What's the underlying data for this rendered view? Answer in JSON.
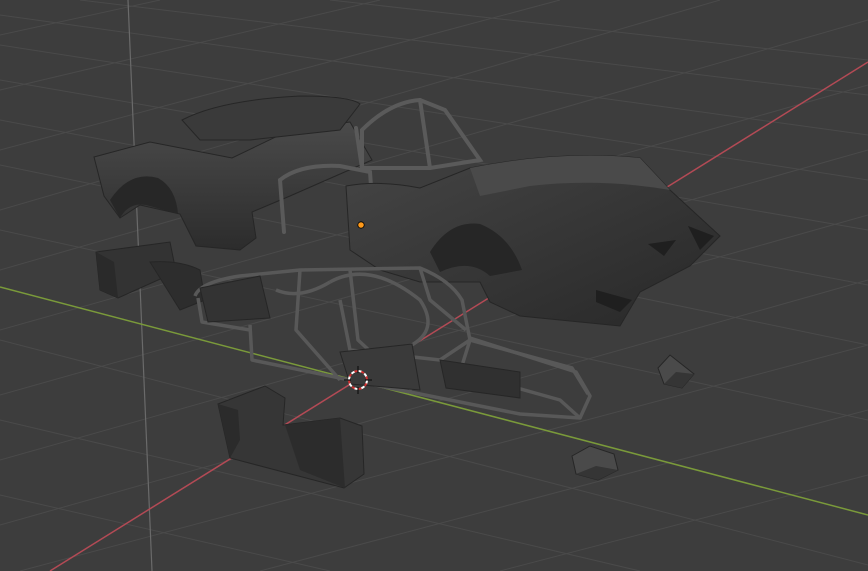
{
  "viewport": {
    "background_color": "#3d3d3d",
    "grid_color": "#4a4a4a",
    "x_axis_color": "#b34a55",
    "y_axis_color": "#7a9a3a",
    "z_axis_color": "#6a6a6a",
    "object_color": "#2f2f2f",
    "object_highlight_color": "#4a4a4a",
    "origin_dot_color": "#ff9a1a",
    "cursor_ring_colors": [
      "#ffffff",
      "#d23030"
    ]
  },
  "objects": [
    {
      "name": "rear-body-panel"
    },
    {
      "name": "front-body-shell"
    },
    {
      "name": "roll-cage-frame"
    },
    {
      "name": "canopy-frame"
    },
    {
      "name": "rear-wing-part"
    },
    {
      "name": "side-pod-part"
    },
    {
      "name": "small-part-1"
    },
    {
      "name": "small-part-2"
    }
  ],
  "icons": {
    "cursor": "3d-cursor-icon",
    "origin": "object-origin-icon"
  }
}
